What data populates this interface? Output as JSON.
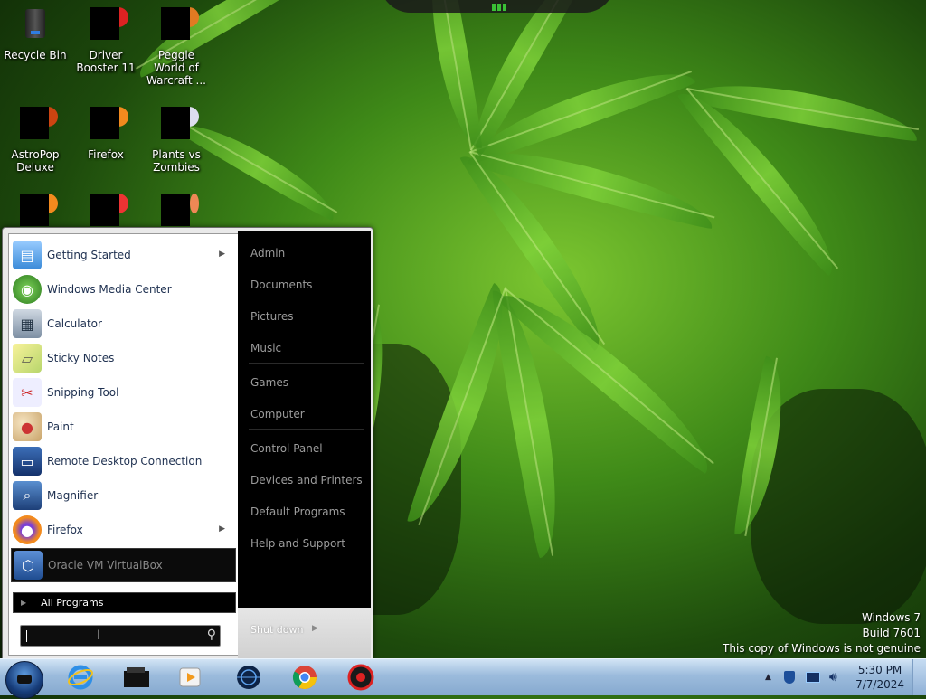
{
  "desktop": {
    "icons": [
      {
        "label": "Recycle Bin"
      },
      {
        "label": "Driver Booster 11"
      },
      {
        "label": "Peggle World of Warcraft ..."
      },
      {
        "label": "AstroPop Deluxe"
      },
      {
        "label": "Firefox"
      },
      {
        "label": "Plants vs Zombies"
      },
      {
        "label": ""
      },
      {
        "label": ""
      },
      {
        "label": ""
      }
    ]
  },
  "start_menu": {
    "programs": [
      {
        "label": "Getting Started",
        "icon": "getting-started-icon",
        "has_submenu": true
      },
      {
        "label": "Windows Media Center",
        "icon": "media-center-icon",
        "has_submenu": false
      },
      {
        "label": "Calculator",
        "icon": "calculator-icon",
        "has_submenu": false
      },
      {
        "label": "Sticky Notes",
        "icon": "sticky-notes-icon",
        "has_submenu": false
      },
      {
        "label": "Snipping Tool",
        "icon": "scissors-icon",
        "has_submenu": false
      },
      {
        "label": "Paint",
        "icon": "palette-icon",
        "has_submenu": false
      },
      {
        "label": "Remote Desktop Connection",
        "icon": "remote-desktop-icon",
        "has_submenu": false
      },
      {
        "label": "Magnifier",
        "icon": "magnifier-icon",
        "has_submenu": false
      },
      {
        "label": "Firefox",
        "icon": "firefox-icon",
        "has_submenu": true
      },
      {
        "label": "Oracle VM VirtualBox",
        "icon": "virtualbox-icon",
        "has_submenu": false,
        "selected": true
      }
    ],
    "all_programs": "All Programs",
    "search_value": "",
    "right_items": [
      {
        "label": "Admin"
      },
      {
        "label": "Documents"
      },
      {
        "label": "Pictures"
      },
      {
        "label": "Music"
      },
      {
        "label": "Games"
      },
      {
        "label": "Computer"
      },
      {
        "label": "Control Panel"
      },
      {
        "label": "Devices and Printers"
      },
      {
        "label": "Default Programs"
      },
      {
        "label": "Help and Support"
      }
    ],
    "shutdown_label": "Shut down"
  },
  "watermark": {
    "line1": "Windows 7",
    "line2": "Build 7601",
    "line3": "This copy of Windows is not genuine"
  },
  "taskbar": {
    "pinned": [
      {
        "icon": "internet-explorer-icon"
      },
      {
        "icon": "file-explorer-icon"
      },
      {
        "icon": "media-player-icon"
      },
      {
        "icon": "globe-app-icon"
      },
      {
        "icon": "chrome-icon"
      },
      {
        "icon": "driver-booster-icon"
      }
    ],
    "clock": {
      "time": "5:30 PM",
      "date": "7/7/2024"
    }
  },
  "colors": {
    "taskbar": "#9bbbdc",
    "start_left": "#ffffff",
    "start_right": "#000000",
    "accent_green": "#3cd03c"
  }
}
